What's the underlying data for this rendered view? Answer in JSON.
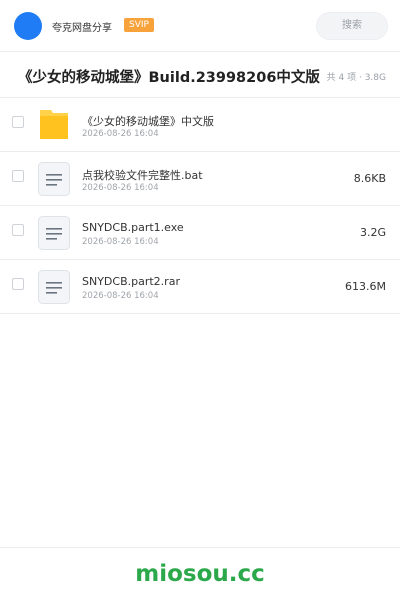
{
  "header": {
    "user_name": "夸克网盘分享",
    "badge": "SVIP",
    "search_label": "搜索"
  },
  "share": {
    "title": "《少女的移动城堡》Build.23998206中文版",
    "summary": "共 4 项 · 3.8G"
  },
  "files": [
    {
      "name": "《少女的移动城堡》中文版",
      "date": "2026-08-26 16:04",
      "size": "",
      "icon": "folder-icon"
    },
    {
      "name": "点我校验文件完整性.bat",
      "date": "2026-08-26 16:04",
      "size": "8.6KB",
      "icon": "document-icon"
    },
    {
      "name": "SNYDCB.part1.exe",
      "date": "2026-08-26 16:04",
      "size": "3.2G",
      "icon": "document-icon"
    },
    {
      "name": "SNYDCB.part2.rar",
      "date": "2026-08-26 16:04",
      "size": "613.6M",
      "icon": "document-icon"
    }
  ],
  "footer": {
    "brand": "miosou.cc"
  },
  "colors": {
    "avatar": "#1f7cf4",
    "badge": "#f7a23b",
    "folder": "#ffc21f",
    "brand": "#2ba84a"
  }
}
